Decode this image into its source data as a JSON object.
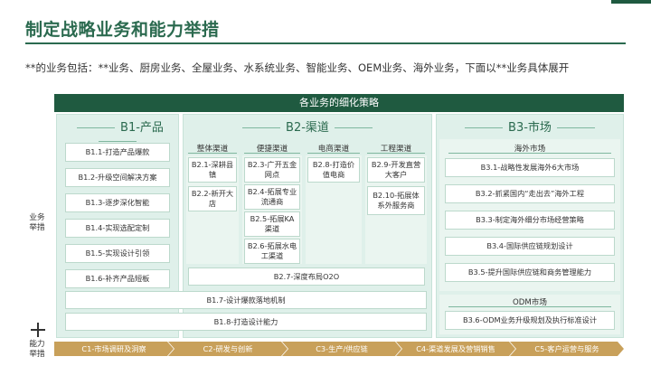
{
  "title": "制定战略业务和能力举措",
  "intro": "**的业务包括：**业务、厨房业务、全屋业务、水系统业务、智能业务、OEM业务、海外业务，下面以**业务具体展开",
  "header": "各业务的细化策略",
  "side_labels": {
    "business": "业务\n举措",
    "capability": "能力\n举措"
  },
  "b1": {
    "title": "B1-产品",
    "items": [
      "B1.1-打造产品爆款",
      "B1.2-升级空间解决方案",
      "B1.3-逐步深化智能",
      "B1.4-实现选配定制",
      "B1.5-实现设计引领",
      "B1.6-补齐产品短板"
    ]
  },
  "b2": {
    "title": "B2-渠道",
    "sub": [
      {
        "name": "整体渠道",
        "items": [
          "B2.1-深耕县镇",
          "B2.2-新开大店"
        ]
      },
      {
        "name": "便捷渠道",
        "items": [
          "B2.3-广开五金网点",
          "B2.4-拓展专业流通商",
          "B2.5-拓展KA渠道",
          "B2.6-拓展水电工渠道"
        ]
      },
      {
        "name": "电商渠道",
        "items": [
          "B2.8-打造价值电商"
        ]
      },
      {
        "name": "工程渠道",
        "items": [
          "B2.9-开发直营大客户",
          "B2.10-拓展体系外服务商"
        ]
      }
    ],
    "wide": "B2.7-深度布局O2O"
  },
  "b3": {
    "title": "B3-市场",
    "overseas": "海外市场",
    "items": [
      "B3.1-战略性发展海外6大市场",
      "B3.2-抓紧国内“走出去”海外工程",
      "B3.3-制定海外细分市场经营策略",
      "B3.4-国际供应链规划设计",
      "B3.5-提升国际供应链和商务管理能力"
    ],
    "odm": "ODM市场",
    "odm_item": "B3.6-ODM业务升级规划及执行标准设计"
  },
  "b1_wide": [
    "B1.7-设计爆款落地机制",
    "B1.8-打造设计能力"
  ],
  "capabilities": [
    "C1-市场调研及洞察",
    "C2-研发与创新",
    "C3-生产/供应链",
    "C4-渠道发展及营销销售",
    "C5-客户运营与服务"
  ]
}
